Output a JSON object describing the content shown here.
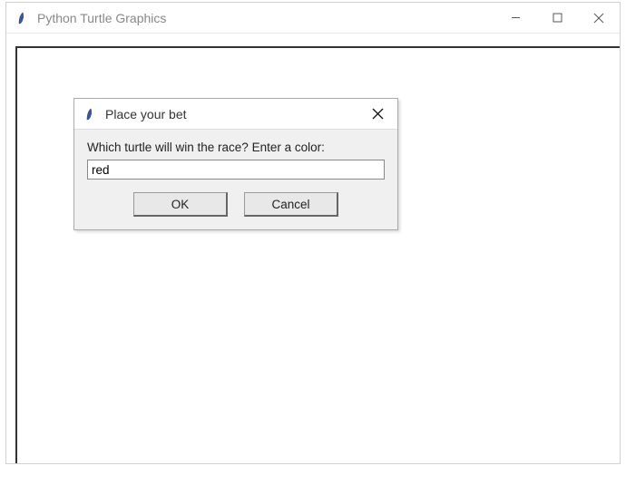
{
  "main_window": {
    "title": "Python Turtle Graphics"
  },
  "dialog": {
    "title": "Place your bet",
    "prompt": "Which turtle will win the race? Enter a color:",
    "input_value": "red",
    "ok_label": "OK",
    "cancel_label": "Cancel"
  }
}
